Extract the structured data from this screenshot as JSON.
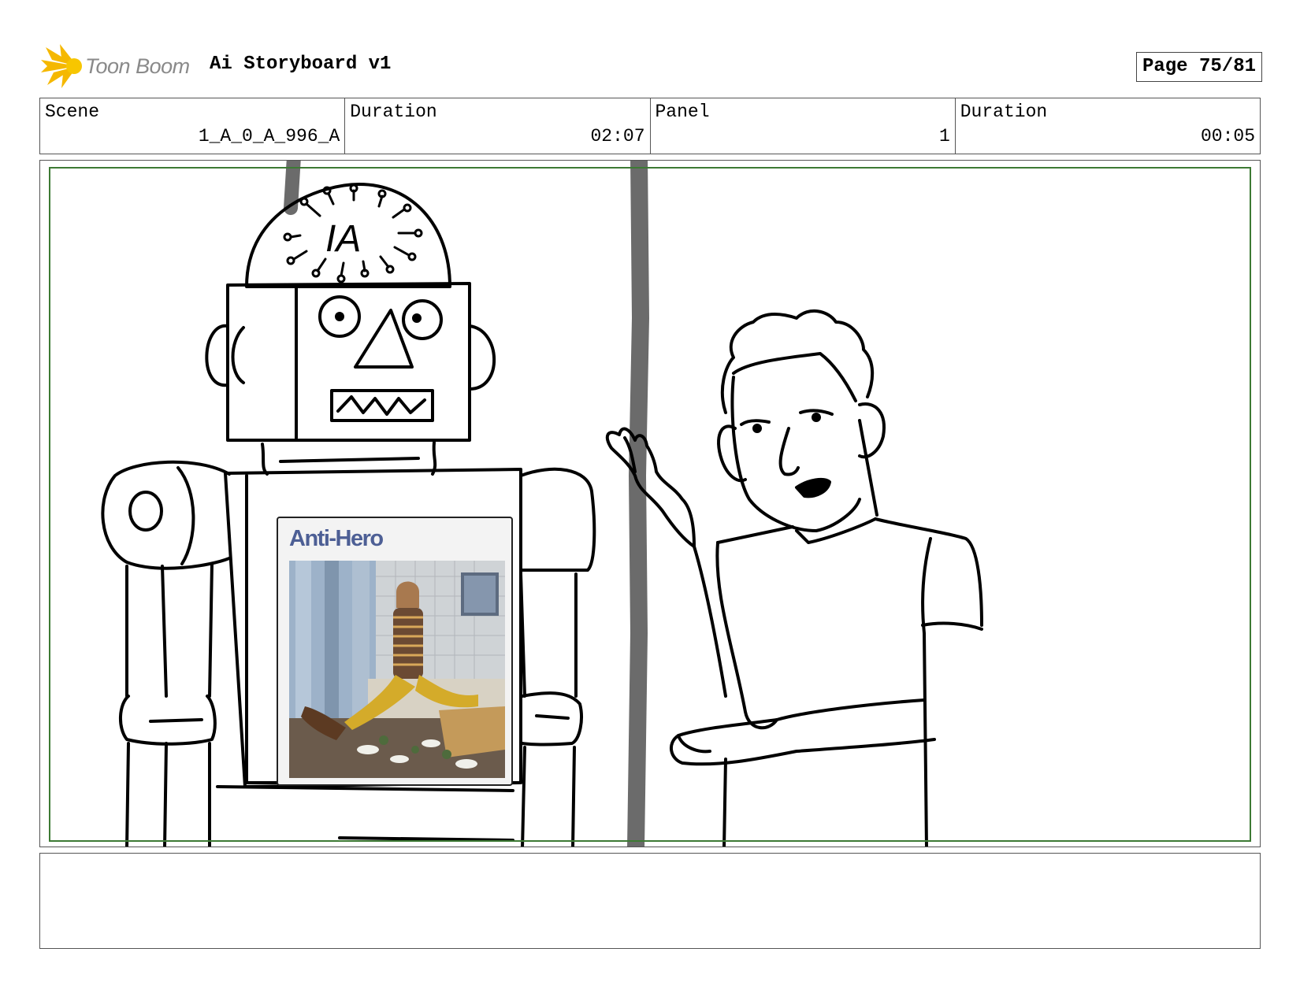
{
  "header": {
    "logo_text": "Toon Boom",
    "title": "Ai Storyboard v1",
    "page": "Page 75/81"
  },
  "info": {
    "scene_label": "Scene",
    "scene_value": "1_A_0_A_996_A",
    "duration_label": "Duration",
    "duration_value": "02:07",
    "panel_label": "Panel",
    "panel_value": "1",
    "panel_duration_label": "Duration",
    "panel_duration_value": "00:05"
  },
  "panel": {
    "robot_head_text": "IA",
    "poster_title": "Anti-Hero"
  },
  "colors": {
    "safe_area": "#3d7a34",
    "logo_star": "#f5b800",
    "logo_text": "#8a8a8a",
    "poster_title": "#4d5f95"
  },
  "notes": ""
}
